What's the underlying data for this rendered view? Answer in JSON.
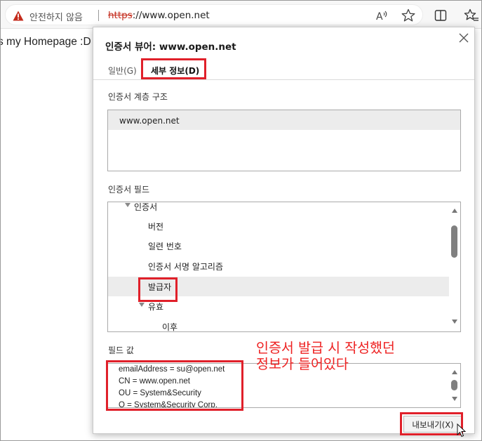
{
  "browser": {
    "security_text": "안전하지 않음",
    "url_scheme": "https",
    "url_rest": "://www.open.net",
    "icons": [
      "warning-icon",
      "read-aloud-icon",
      "favorite-star-icon",
      "split-screen-icon",
      "favorites-icon"
    ]
  },
  "page": {
    "visible_text": "s my Homepage :D"
  },
  "dialog": {
    "title": "인증서 뷰어: www.open.net",
    "tabs": [
      {
        "label": "일반(G)",
        "active": false
      },
      {
        "label": "세부 정보(D)",
        "active": true
      }
    ],
    "hierarchy_label": "인증서 계층 구조",
    "hierarchy_items": [
      {
        "label": "www.open.net",
        "selected": true
      }
    ],
    "fields_label": "인증서 필드",
    "fields": [
      {
        "label": "인증서",
        "expanded": true,
        "selected": false
      },
      {
        "label": "버전",
        "selected": false
      },
      {
        "label": "일련 번호",
        "selected": false
      },
      {
        "label": "인증서 서명 알고리즘",
        "selected": false
      },
      {
        "label": "발급자",
        "selected": true
      },
      {
        "label": "유효",
        "expanded": true,
        "selected": false
      },
      {
        "label": "이후",
        "selected": false
      }
    ],
    "value_label": "필드 값",
    "value_lines": [
      "emailAddress = su@open.net",
      "CN = www.open.net",
      "OU = System&Security",
      "O = System&Security Corp."
    ],
    "export_button": "내보내기(X)"
  },
  "annotation": {
    "text": "인증서 발급 시 작성했던\n정보가 들어있다",
    "color": "#ee2222"
  },
  "colors": {
    "highlight_box": "#e0202a",
    "selection": "#ececec",
    "insecure": "#c42b1c"
  }
}
